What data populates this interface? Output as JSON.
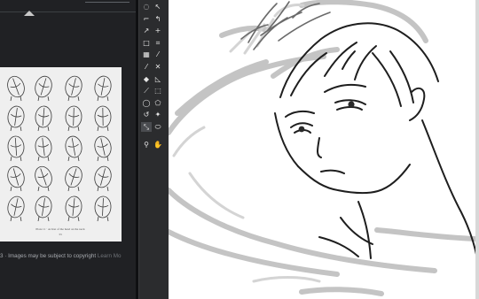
{
  "preview": {
    "reference_image_caption": "Plate 11 · Action of the head on the neck",
    "reference_image_page": "33",
    "copyright_prefix": "3 · Images may be subject to copyright",
    "learn_more": "Learn Mo"
  },
  "tools": [
    {
      "icon": "lasso-icon",
      "glyph": "◌"
    },
    {
      "icon": "pen-cursor-icon",
      "glyph": "↖"
    },
    {
      "icon": "polyline-icon",
      "glyph": "⌐"
    },
    {
      "icon": "freehand-select-icon",
      "glyph": "↰"
    },
    {
      "icon": "curve-icon",
      "glyph": "↗"
    },
    {
      "icon": "move-icon",
      "glyph": "+"
    },
    {
      "icon": "rect-icon",
      "glyph": "□"
    },
    {
      "icon": "crop-icon",
      "glyph": "⌗"
    },
    {
      "icon": "gradient-icon",
      "glyph": "▦"
    },
    {
      "icon": "eyedropper-icon",
      "glyph": "⁄"
    },
    {
      "icon": "brush-icon",
      "glyph": "⁄"
    },
    {
      "icon": "eraser-icon",
      "glyph": "✕"
    },
    {
      "icon": "bucket-icon",
      "glyph": "◆"
    },
    {
      "icon": "ruler-icon",
      "glyph": "◺"
    },
    {
      "icon": "line-icon",
      "glyph": "⟋"
    },
    {
      "icon": "marquee-icon",
      "glyph": "⬚"
    },
    {
      "icon": "ellipse-select-icon",
      "glyph": "◯"
    },
    {
      "icon": "polygon-select-icon",
      "glyph": "⬠"
    },
    {
      "icon": "lasso-fill-icon",
      "glyph": "↺"
    },
    {
      "icon": "magic-wand-icon",
      "glyph": "✦"
    },
    {
      "icon": "transform-icon",
      "glyph": "⤡"
    },
    {
      "icon": "shape-icon",
      "glyph": "⬭"
    },
    {
      "icon": "zoom-icon",
      "glyph": "⚲"
    },
    {
      "icon": "hand-icon",
      "glyph": "✋"
    }
  ]
}
